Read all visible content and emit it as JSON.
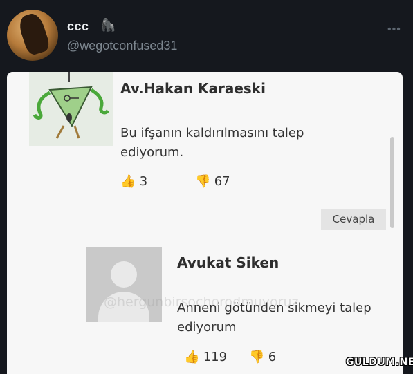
{
  "tweet": {
    "display_name": "ccc",
    "name_emoji": "🦍",
    "handle": "@wegotconfused31",
    "more_icon": "more-horizontal-icon"
  },
  "comments": [
    {
      "author": "Av.Hakan Karaeski",
      "text": "Bu ifşanın kaldırılmasını talep ediyorum.",
      "likes": "3",
      "dislikes": "67",
      "reply_label": "Cevapla"
    },
    {
      "author": "Avukat Siken",
      "text": "Anneni götünden sikmeyi talep ediyorum",
      "likes": "119",
      "dislikes": "6",
      "watermark": "@hergunbirsochorodmuyoruz"
    }
  ],
  "icons": {
    "like": "thumbs-up-icon",
    "dislike": "thumbs-down-icon"
  },
  "site_badge": "GULDUM.NET"
}
